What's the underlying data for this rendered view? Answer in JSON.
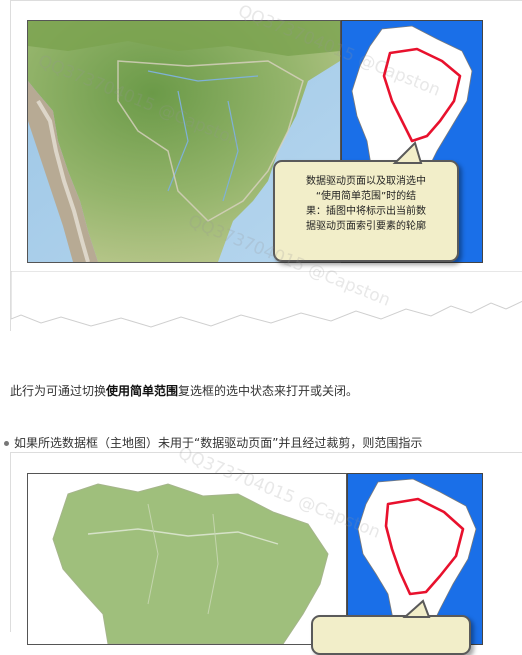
{
  "figure1": {
    "callout_lines": [
      "数据驱动页面以及取消选中",
      "“使用简单范围”时的结",
      "果：插图中将标示出当前数",
      "据驱动页面索引要素的轮廓"
    ]
  },
  "paragraph": {
    "before": "此行为可通过切换",
    "bold": "使用简单范围",
    "after": "复选框的选中状态来打开或关闭。"
  },
  "bullet": {
    "text": "如果所选数据框（主地图）未用于“数据驱动页面”并且经过裁剪，则范围指示"
  },
  "watermark": {
    "text": "QQ373704015 @Capston"
  },
  "colors": {
    "ocean_inset": "#1a6fe8",
    "highlight": "#e8112d",
    "callout_bg": "#f2eec9"
  }
}
